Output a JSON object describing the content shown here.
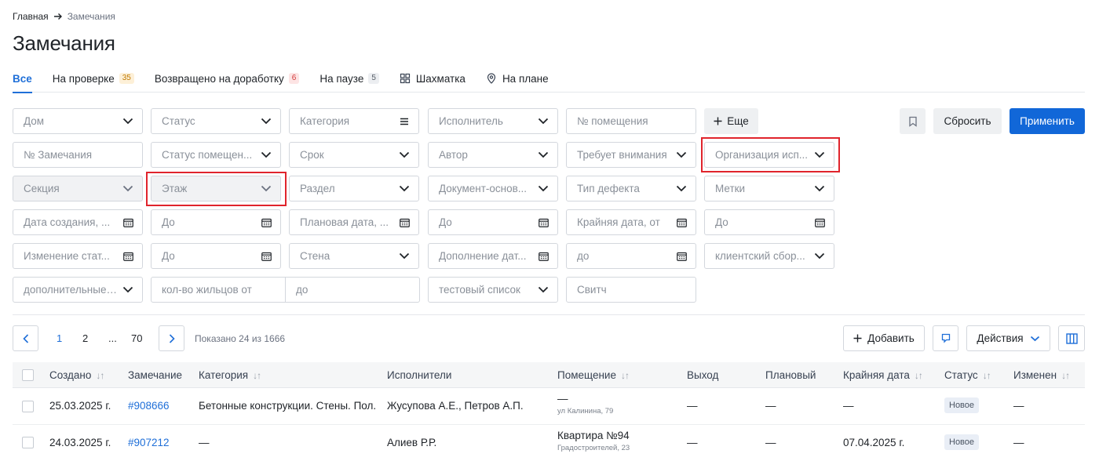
{
  "breadcrumb": {
    "home": "Главная",
    "current": "Замечания"
  },
  "page_title": "Замечания",
  "tabs": [
    {
      "label": "Все",
      "badge": ""
    },
    {
      "label": "На проверке",
      "badge": "35"
    },
    {
      "label": "Возвращено на доработку",
      "badge": "6"
    },
    {
      "label": "На паузе",
      "badge": "5"
    },
    {
      "label": "Шахматка",
      "badge": ""
    },
    {
      "label": "На плане",
      "badge": ""
    }
  ],
  "filters": {
    "dom": "Дом",
    "status": "Статус",
    "category": "Категория",
    "executor": "Исполнитель",
    "room_no": "№ помещения",
    "more": "Еще",
    "remark_no": "№ Замечания",
    "room_status": "Статус помещен...",
    "deadline": "Срок",
    "author": "Автор",
    "needs_attention": "Требует внимания",
    "org_executor": "Организация исп...",
    "section": "Секция",
    "floor": "Этаж",
    "chapter": "Раздел",
    "basis_doc": "Документ-основ...",
    "defect_type": "Тип дефекта",
    "tags": "Метки",
    "created_from": "Дата создания, ...",
    "created_to": "До",
    "planned_from": "Плановая дата, ...",
    "planned_to": "До",
    "deadline_from": "Крайняя дата, от",
    "deadline_to": "До",
    "status_change_from": "Изменение стат...",
    "status_change_to": "До",
    "wall": "Стена",
    "addition_date": "Дополнение дат...",
    "addition_to": "до",
    "client_build": "клиентский сбор...",
    "additional": "дополнительные ...",
    "residents_from": "кол-во жильцов от",
    "residents_to": "до",
    "test_list": "тестовый список",
    "switch": "Свитч"
  },
  "actions": {
    "reset": "Сбросить",
    "apply": "Применить",
    "add": "Добавить",
    "actions": "Действия"
  },
  "pagination": {
    "pages": [
      "1",
      "2",
      "...",
      "70"
    ],
    "shown": "Показано 24 из 1666"
  },
  "table": {
    "columns": [
      "Создано",
      "Замечание",
      "Категория",
      "Исполнители",
      "Помещение",
      "Выход",
      "Плановый",
      "Крайняя дата",
      "Статус",
      "Изменен"
    ],
    "rows": [
      {
        "created": "25.03.2025 г.",
        "remark": "#908666",
        "category": "Бетонные конструкции. Стены. Пол.",
        "executors": "Жусупова А.Е., Петров А.П.",
        "room": "—",
        "room_sub": "ул Калинина, 79",
        "exit": "—",
        "planned": "—",
        "deadline": "—",
        "status": "Новое",
        "changed": "—"
      },
      {
        "created": "24.03.2025 г.",
        "remark": "#907212",
        "category": "—",
        "executors": "Алиев Р.Р.",
        "room": "Квартира №94",
        "room_sub": "Градостроителей, 23",
        "exit": "—",
        "planned": "—",
        "deadline": "07.04.2025 г.",
        "status": "Новое",
        "changed": "—"
      }
    ]
  },
  "colors": {
    "accent": "#1167d8",
    "highlight": "#e0242c"
  },
  "icons": [
    "arrow-right-icon",
    "grid-icon",
    "location-pin-icon",
    "chevron-down-icon",
    "list-icon",
    "calendar-icon",
    "plus-icon",
    "bookmark-icon",
    "chevron-left-icon",
    "chevron-right-icon",
    "columns-icon",
    "flag-icon"
  ]
}
